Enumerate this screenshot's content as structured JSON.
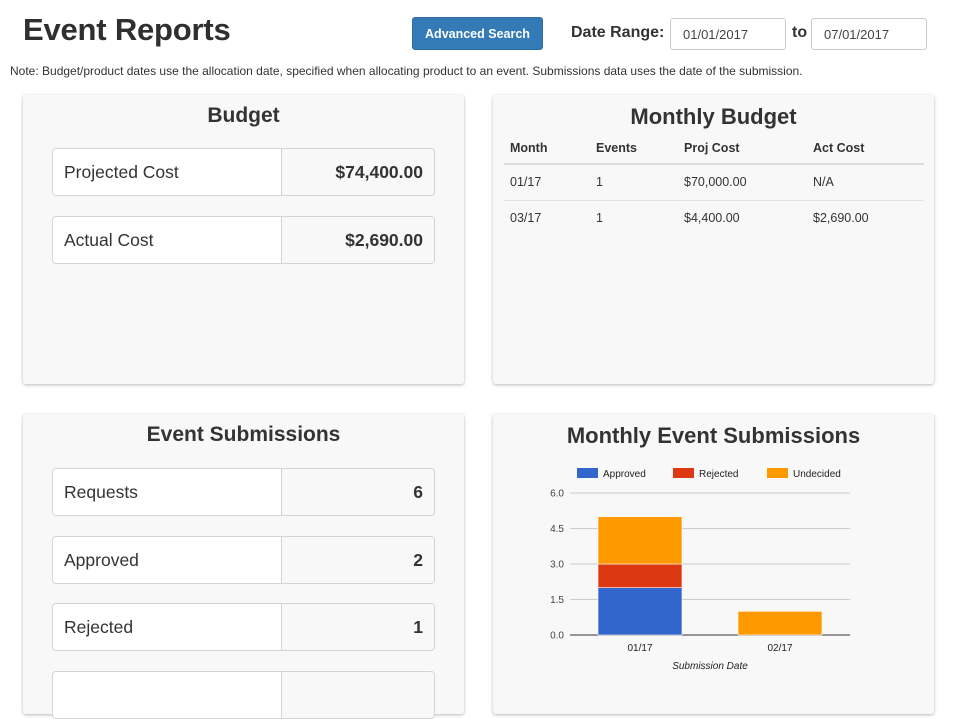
{
  "header": {
    "title": "Event Reports",
    "advanced_search_label": "Advanced Search",
    "date_range_label": "Date Range:",
    "date_from": "01/01/2017",
    "to_label": "to",
    "date_to": "07/01/2017"
  },
  "note": "Note: Budget/product dates use the allocation date, specified when allocating product to an event. Submissions data uses the date of the submission.",
  "budget": {
    "title": "Budget",
    "rows": [
      {
        "label": "Projected Cost",
        "value": "$74,400.00"
      },
      {
        "label": "Actual Cost",
        "value": "$2,690.00"
      }
    ]
  },
  "monthly_budget": {
    "title": "Monthly Budget",
    "columns": [
      "Month",
      "Events",
      "Proj Cost",
      "Act Cost"
    ],
    "rows": [
      [
        "01/17",
        "1",
        "$70,000.00",
        "N/A"
      ],
      [
        "03/17",
        "1",
        "$4,400.00",
        "$2,690.00"
      ]
    ]
  },
  "event_submissions": {
    "title": "Event Submissions",
    "rows": [
      {
        "label": "Requests",
        "value": "6"
      },
      {
        "label": "Approved",
        "value": "2"
      },
      {
        "label": "Rejected",
        "value": "1"
      },
      {
        "label": "",
        "value": ""
      }
    ]
  },
  "monthly_event_submissions": {
    "title": "Monthly Event Submissions"
  },
  "chart_data": {
    "type": "bar",
    "stacked": true,
    "title": "Monthly Event Submissions",
    "categories": [
      "01/17",
      "02/17"
    ],
    "series": [
      {
        "name": "Approved",
        "color": "#3366cc",
        "values": [
          2,
          0
        ]
      },
      {
        "name": "Rejected",
        "color": "#dc3912",
        "values": [
          1,
          0
        ]
      },
      {
        "name": "Undecided",
        "color": "#ff9900",
        "values": [
          2,
          1
        ]
      }
    ],
    "xlabel": "Submission Date",
    "ylabel": "",
    "ylim": [
      0,
      6
    ],
    "yticks": [
      "0.0",
      "1.5",
      "3.0",
      "4.5",
      "6.0"
    ],
    "ytick_values": [
      0,
      1.5,
      3,
      4.5,
      6
    ],
    "grid": true,
    "legend": "top"
  }
}
